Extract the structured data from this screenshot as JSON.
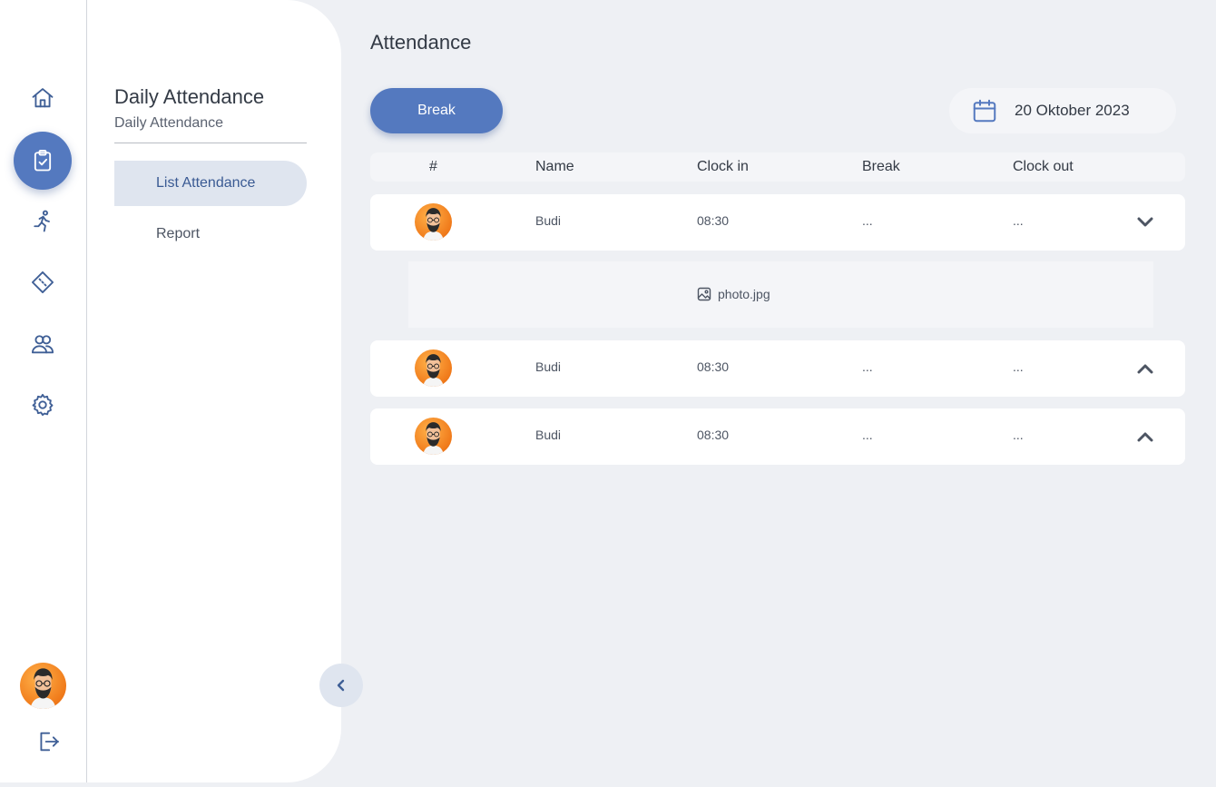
{
  "rail": {
    "items": [
      {
        "icon": "home-icon"
      },
      {
        "icon": "clipboard-check-icon",
        "active": true
      },
      {
        "icon": "running-person-icon"
      },
      {
        "icon": "ticket-icon"
      },
      {
        "icon": "users-icon"
      },
      {
        "icon": "gear-icon"
      }
    ],
    "user_avatar": "avatar",
    "logout_icon": "logout-icon"
  },
  "subnav": {
    "title": "Daily Attendance",
    "subtitle": "Daily Attendance",
    "items": [
      {
        "label": "List Attendance",
        "active": true
      },
      {
        "label": "Report",
        "active": false
      }
    ]
  },
  "main": {
    "title": "Attendance",
    "break_button": "Break",
    "date": "20 Oktober 2023",
    "table": {
      "headers": [
        "#",
        "Name",
        "Clock in",
        "Break",
        "Clock out"
      ],
      "rows": [
        {
          "name": "Budi",
          "clock_in": "08:30",
          "break": "...",
          "clock_out": "...",
          "expanded": true
        },
        {
          "name": "Budi",
          "clock_in": "08:30",
          "break": "...",
          "clock_out": "...",
          "expanded": false
        },
        {
          "name": "Budi",
          "clock_in": "08:30",
          "break": "...",
          "clock_out": "...",
          "expanded": false
        }
      ],
      "attachment": "photo.jpg"
    }
  },
  "colors": {
    "accent": "#5479bf",
    "background": "#eef0f4",
    "active_item_bg": "#dfe5ef"
  }
}
